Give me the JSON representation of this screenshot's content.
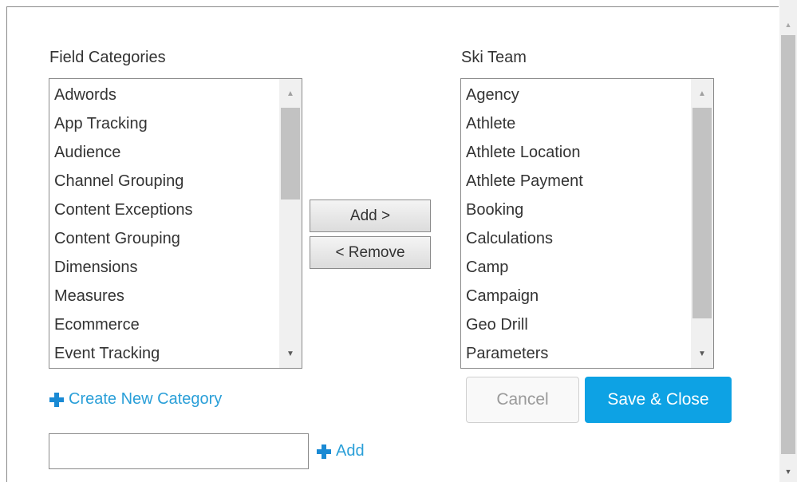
{
  "left_panel": {
    "title": "Field Categories",
    "items": [
      "Adwords",
      "App Tracking",
      "Audience",
      "Channel Grouping",
      "Content Exceptions",
      "Content Grouping",
      "Dimensions",
      "Measures",
      "Ecommerce",
      "Event Tracking"
    ]
  },
  "right_panel": {
    "title": "Ski Team",
    "items": [
      "Agency",
      "Athlete",
      "Athlete Location",
      "Athlete Payment",
      "Booking",
      "Calculations",
      "Camp",
      "Campaign",
      "Geo Drill",
      "Parameters"
    ]
  },
  "transfer": {
    "add_label": "Add >",
    "remove_label": "< Remove"
  },
  "create_category": {
    "link_label": "Create New Category",
    "input_value": "",
    "add_label": "Add"
  },
  "footer": {
    "cancel_label": "Cancel",
    "save_label": "Save & Close"
  },
  "icons": {
    "plus": "plus-icon",
    "scroll_up": "scroll-up-icon",
    "scroll_down": "scroll-down-icon"
  },
  "colors": {
    "accent_link": "#2a9fd8",
    "primary_button": "#0da2e4",
    "text": "#333333"
  }
}
